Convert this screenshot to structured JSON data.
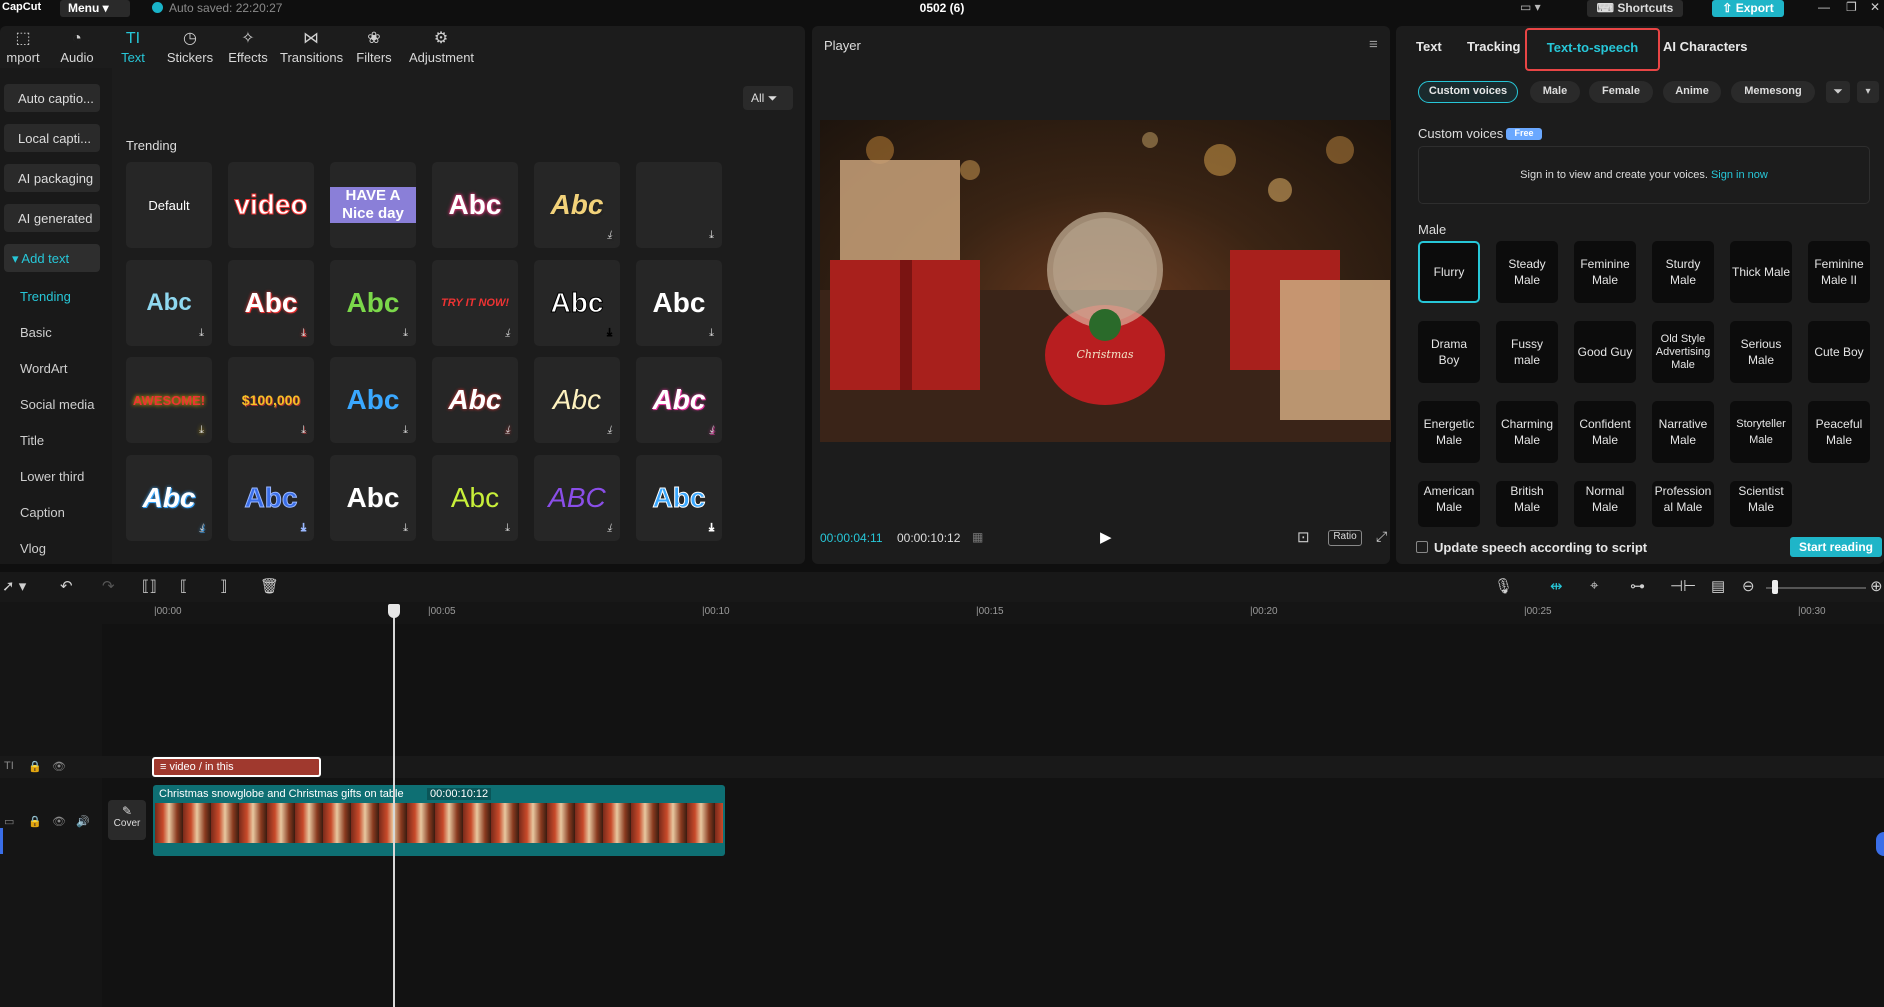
{
  "app": {
    "logo": "CapCut",
    "menu_label": "Menu",
    "autosave": "Auto saved: 22:20:27",
    "project_title": "0502 (6)",
    "shortcuts_label": "Shortcuts",
    "export_label": "Export"
  },
  "toolbar": {
    "tabs": [
      {
        "label": "mport",
        "icon": "import-icon"
      },
      {
        "label": "Audio",
        "icon": "audio-icon"
      },
      {
        "label": "Text",
        "icon": "text-icon",
        "active": true
      },
      {
        "label": "Stickers",
        "icon": "sticker-icon"
      },
      {
        "label": "Effects",
        "icon": "effects-icon"
      },
      {
        "label": "Transitions",
        "icon": "transitions-icon"
      },
      {
        "label": "Filters",
        "icon": "filters-icon"
      },
      {
        "label": "Adjustment",
        "icon": "adjustment-icon"
      }
    ]
  },
  "categories": {
    "buttons": [
      "Auto captio...",
      "Local capti...",
      "AI packaging",
      "AI generated",
      "Add text"
    ],
    "sub": [
      "Trending",
      "Basic",
      "WordArt",
      "Social media",
      "Title",
      "Lower third",
      "Caption",
      "Vlog"
    ]
  },
  "text_panel": {
    "filter_label": "All",
    "section_label": "Trending",
    "tiles": [
      [
        "Default",
        "video",
        "HAVE A Nice day",
        "Abc",
        "Abc",
        ""
      ],
      [
        "Abc",
        "Abc",
        "Abc",
        "TRY IT NOW!",
        "Abc",
        "Abc"
      ],
      [
        "AWESOME!",
        "$100,000",
        "Abc",
        "Abc",
        "Abc",
        "Abc"
      ],
      [
        "Abc",
        "Abc",
        "Abc",
        "Abc",
        "ABC",
        "Abc"
      ]
    ]
  },
  "player": {
    "title": "Player",
    "current_time": "00:00:04:11",
    "total_time": "00:00:10:12",
    "ratio_label": "Ratio",
    "scene_text": "Christmas"
  },
  "right_panel": {
    "tabs": [
      "Text",
      "Tracking",
      "Text-to-speech",
      "AI Characters"
    ],
    "chips": [
      "Custom voices",
      "Male",
      "Female",
      "Anime",
      "Memesong"
    ],
    "custom_voices_label": "Custom voices",
    "free_badge": "Free",
    "signin_text": "Sign in to view and create your voices.",
    "signin_link": "Sign in now",
    "male_label": "Male",
    "voices": [
      [
        "Flurry",
        "Steady Male",
        "Feminine Male",
        "Sturdy Male",
        "Thick Male",
        "Feminine Male II"
      ],
      [
        "Drama Boy",
        "Fussy male",
        "Good Guy",
        "Old Style Advertising Male",
        "Serious Male",
        "Cute Boy"
      ],
      [
        "Energetic Male",
        "Charming Male",
        "Confident Male",
        "Narrative Male",
        "Storyteller Male",
        "Peaceful Male"
      ],
      [
        "American Male",
        "British Male",
        "Normal Male",
        "Professional Male",
        "Scientist Male"
      ]
    ],
    "update_label": "Update speech according to script",
    "start_label": "Start reading"
  },
  "timeline": {
    "ticks": [
      "|00:00",
      "|00:05",
      "|00:10",
      "|00:15",
      "|00:20",
      "|00:25",
      "|00:30"
    ],
    "text_clip": "video / in this",
    "video_clip": "Christmas snowglobe and Christmas gifts on table",
    "video_duration": "00:00:10:12",
    "cover_label": "Cover"
  }
}
